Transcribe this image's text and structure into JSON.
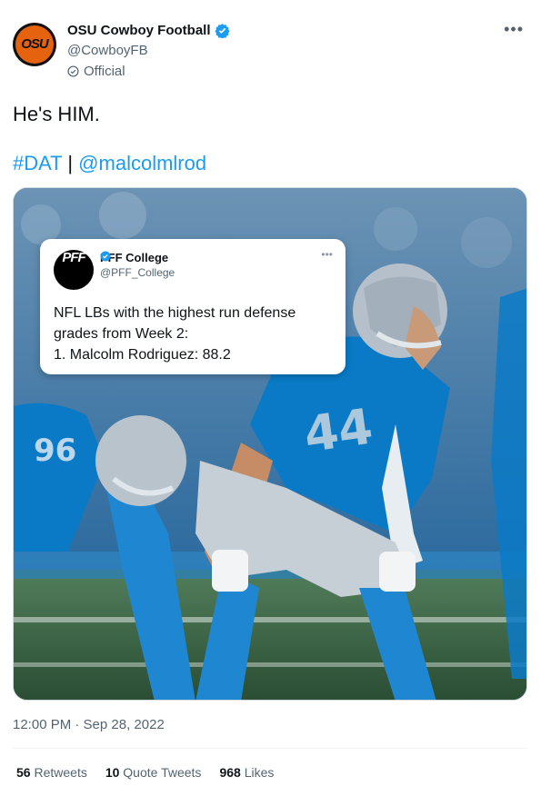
{
  "author": {
    "display_name": "OSU Cowboy Football",
    "handle": "@CowboyFB",
    "label": "Official",
    "avatar_text": "OSU"
  },
  "tweet": {
    "text": "He's HIM.",
    "hashtag": "#DAT",
    "separator": " | ",
    "mention": "@malcolmlrod",
    "timestamp": "12:00 PM · Sep 28, 2022"
  },
  "embedded_tweet": {
    "display_name": "PFF College",
    "handle": "@PFF_College",
    "avatar_text": "PFF",
    "line1": "NFL LBs with the highest run defense",
    "line2": "grades from Week 2:",
    "line3": "1. Malcolm Rodriguez: 88.2"
  },
  "media": {
    "jersey_number": "44",
    "other_jersey_number": "96"
  },
  "stats": {
    "retweets_count": "56",
    "retweets_label": "Retweets",
    "quote_count": "10",
    "quote_label": "Quote Tweets",
    "likes_count": "968",
    "likes_label": "Likes"
  },
  "colors": {
    "accent": "#1d9bf0",
    "lions_blue": "#0a7ac7",
    "osu_orange": "#e5630f"
  }
}
